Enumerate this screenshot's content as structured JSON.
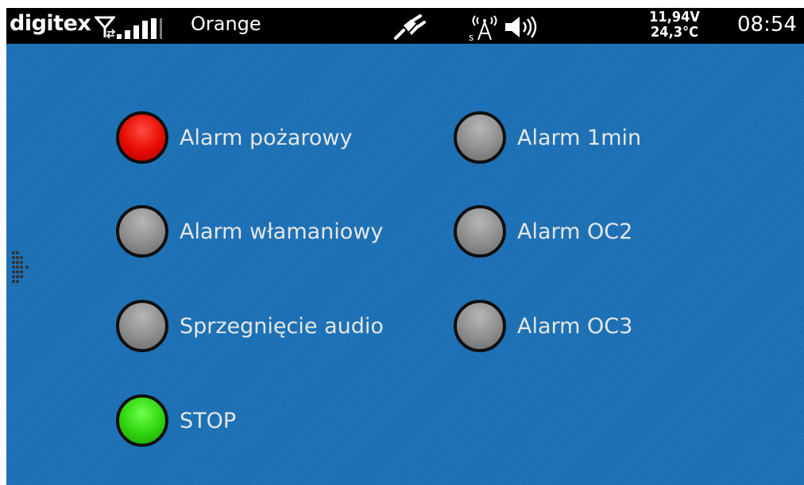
{
  "status_bar": {
    "brand": "digitex",
    "carrier": "Orange",
    "voltage": "11,94V",
    "temperature": "24,3°C",
    "time": "08:54",
    "icons": [
      "antenna-transfer-icon",
      "signal-strength-icon",
      "unplugged-icon",
      "radio-sa-icon",
      "speaker-volume-icon"
    ]
  },
  "controls": [
    {
      "label": "Alarm pożarowy",
      "state": "red"
    },
    {
      "label": "Alarm 1min",
      "state": "gray"
    },
    {
      "label": "Alarm włamaniowy",
      "state": "gray"
    },
    {
      "label": "Alarm OC2",
      "state": "gray"
    },
    {
      "label": "Sprzegnięcie audio",
      "state": "gray"
    },
    {
      "label": "Alarm OC3",
      "state": "gray"
    },
    {
      "label": "STOP",
      "state": "green"
    }
  ],
  "colors": {
    "background": "#1a6fb4",
    "status_bar": "#000000",
    "red": "#e60a00",
    "gray": "#8d8d8d",
    "green": "#2ed30d",
    "label_text": "#e6e6e6"
  }
}
